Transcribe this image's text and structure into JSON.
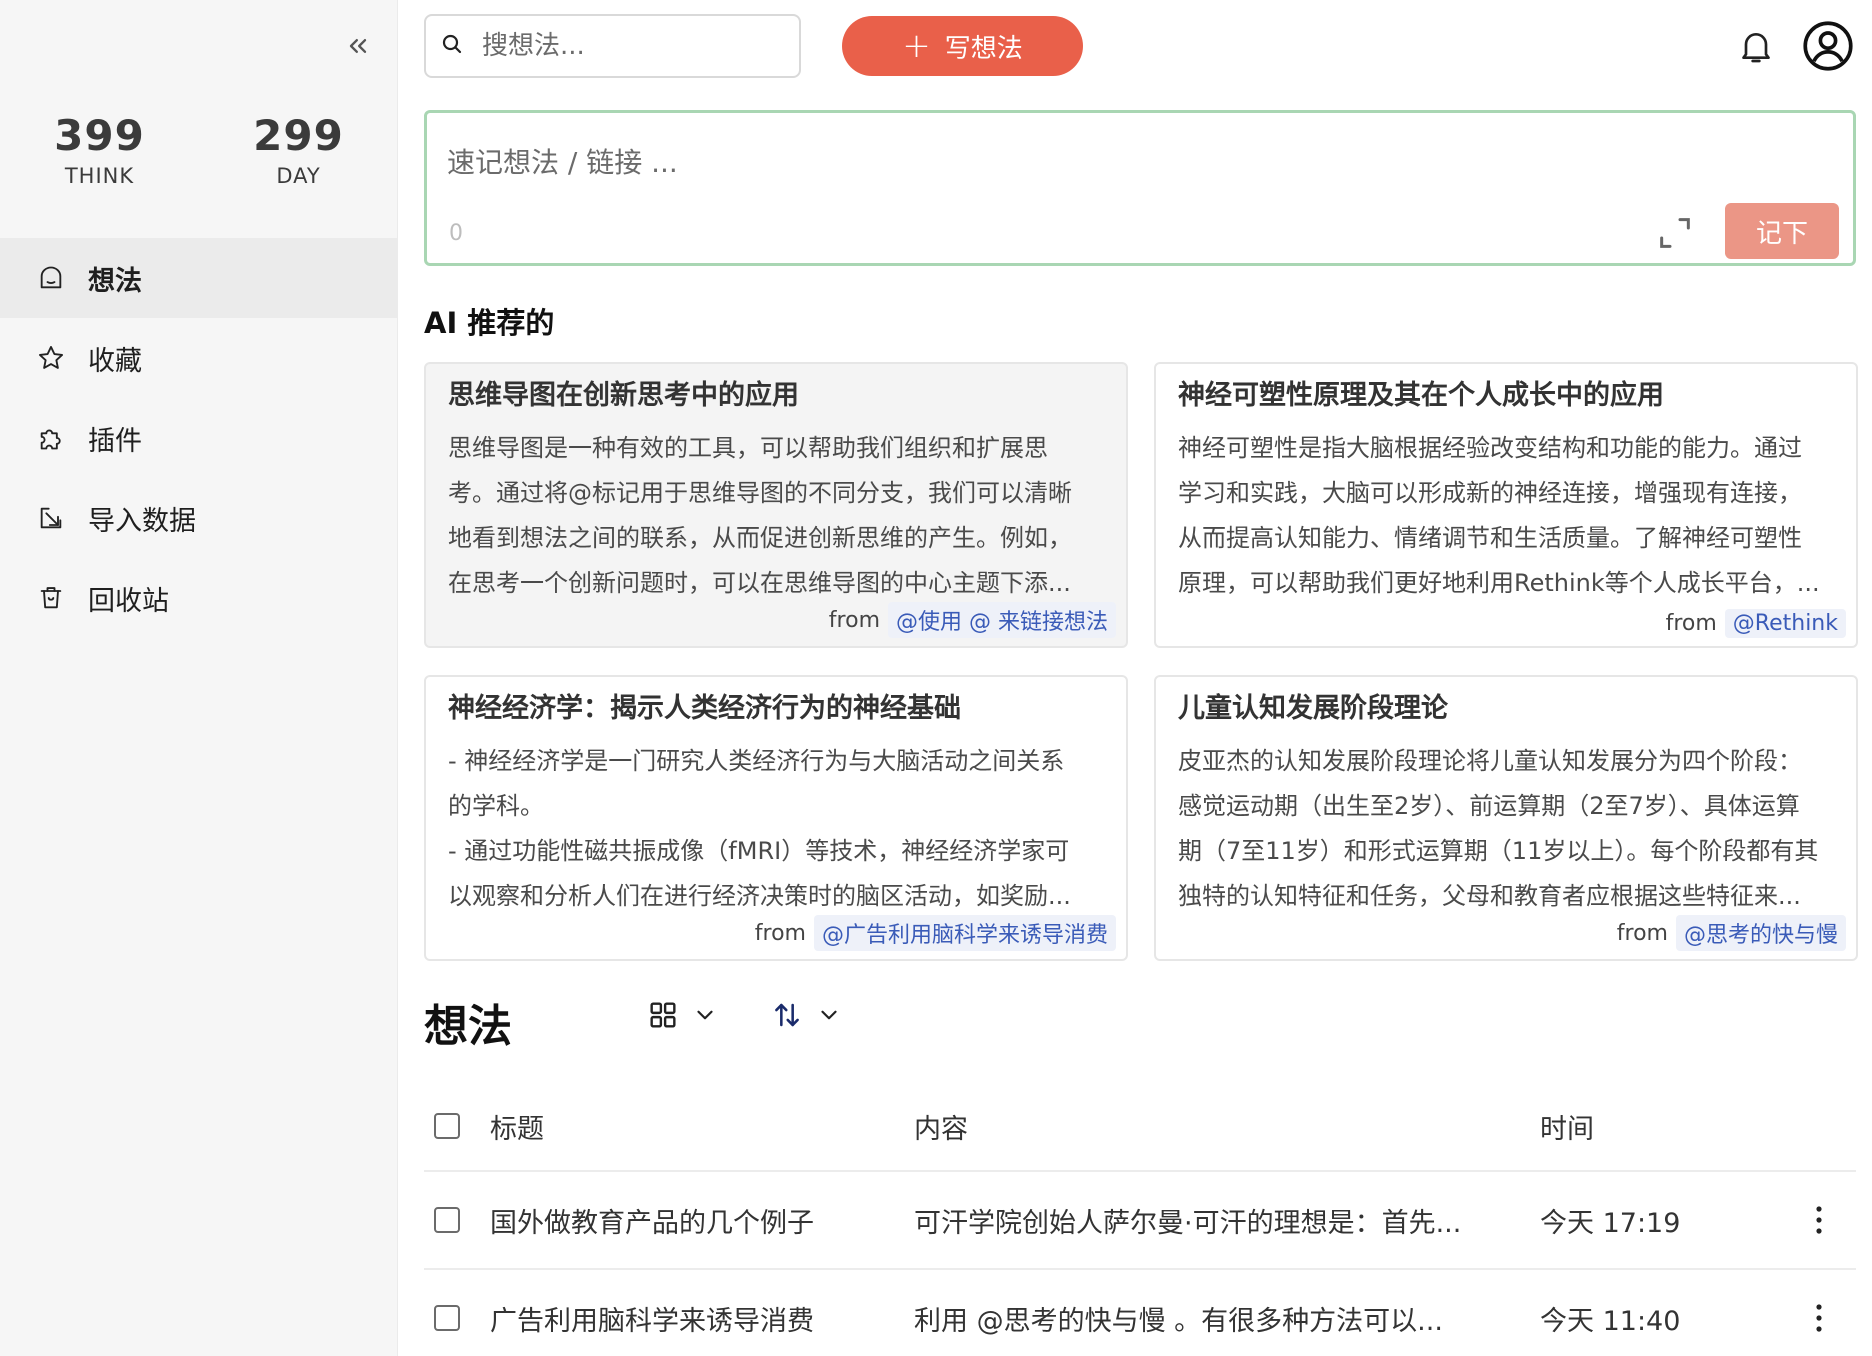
{
  "sidebar": {
    "stats": [
      {
        "value": "399",
        "label": "THINK"
      },
      {
        "value": "299",
        "label": "DAY"
      }
    ],
    "items": [
      {
        "label": "想法",
        "icon": "home-icon"
      },
      {
        "label": "收藏",
        "icon": "star-icon"
      },
      {
        "label": "插件",
        "icon": "puzzle-icon"
      },
      {
        "label": "导入数据",
        "icon": "import-icon"
      },
      {
        "label": "回收站",
        "icon": "trash-icon"
      }
    ]
  },
  "topbar": {
    "search_placeholder": "搜想法...",
    "write_label": "写想法"
  },
  "quick_note": {
    "placeholder": "速记想法 / 链接 ...",
    "char_count": "0",
    "submit_label": "记下"
  },
  "ai": {
    "title": "AI 推荐的",
    "from_label": "from",
    "cards": [
      {
        "title": "思维导图在创新思考中的应用",
        "body": "思维导图是一种有效的工具，可以帮助我们组织和扩展思\n考。通过将@标记用于思维导图的不同分支，我们可以清晰\n地看到想法之间的联系，从而促进创新思维的产生。例如，\n在思考一个创新问题时，可以在思维导图的中心主题下添...",
        "source": "@使用 @ 来链接想法"
      },
      {
        "title": "神经可塑性原理及其在个人成长中的应用",
        "body": "神经可塑性是指大脑根据经验改变结构和功能的能力。通过\n学习和实践，大脑可以形成新的神经连接，增强现有连接，\n从而提高认知能力、情绪调节和生活质量。了解神经可塑性\n原理，可以帮助我们更好地利用Rethink等个人成长平台，...",
        "source": "@Rethink"
      },
      {
        "title": "神经经济学：揭示人类经济行为的神经基础",
        "body": "- 神经经济学是一门研究人类经济行为与大脑活动之间关系\n的学科。\n- 通过功能性磁共振成像（fMRI）等技术，神经经济学家可\n以观察和分析人们在进行经济决策时的脑区活动，如奖励...",
        "source": "@广告利用脑科学来诱导消费"
      },
      {
        "title": "儿童认知发展阶段理论",
        "body": "皮亚杰的认知发展阶段理论将儿童认知发展分为四个阶段：\n感觉运动期（出生至2岁）、前运算期（2至7岁）、具体运算\n期（7至11岁）和形式运算期（11岁以上）。每个阶段都有其\n独特的认知特征和任务，父母和教育者应根据这些特征来...",
        "source": "@思考的快与慢"
      }
    ]
  },
  "list": {
    "title": "想法",
    "columns": {
      "title": "标题",
      "content": "内容",
      "time": "时间"
    },
    "rows": [
      {
        "title": "国外做教育产品的几个例子",
        "content": "可汗学院创始人萨尔曼·可汗的理想是：首先...",
        "time": "今天 17:19"
      },
      {
        "title": "广告利用脑科学来诱导消费",
        "content": "利用 @思考的快与慢 。有很多种方法可以...",
        "time": "今天 11:40"
      }
    ]
  },
  "colors": {
    "accent": "#e9604a",
    "submit": "#eb9686",
    "quick_border": "#a9d6b3",
    "tag_text": "#3a5bb8"
  }
}
